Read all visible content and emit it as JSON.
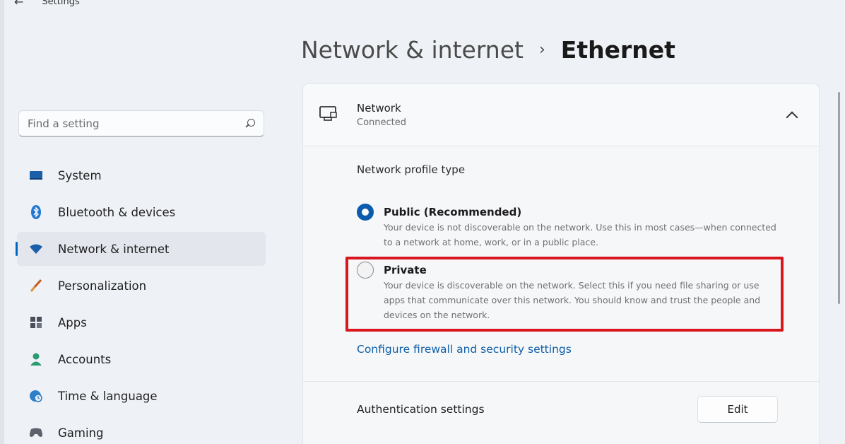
{
  "window": {
    "title": "Settings"
  },
  "search": {
    "placeholder": "Find a setting"
  },
  "sidebar": {
    "items": [
      {
        "label": "System",
        "icon": "monitor-icon"
      },
      {
        "label": "Bluetooth & devices",
        "icon": "bluetooth-icon"
      },
      {
        "label": "Network & internet",
        "icon": "wifi-icon",
        "active": true
      },
      {
        "label": "Personalization",
        "icon": "brush-icon"
      },
      {
        "label": "Apps",
        "icon": "apps-icon"
      },
      {
        "label": "Accounts",
        "icon": "person-icon"
      },
      {
        "label": "Time & language",
        "icon": "globe-clock-icon"
      },
      {
        "label": "Gaming",
        "icon": "controller-icon"
      }
    ]
  },
  "header": {
    "parent": "Network & internet",
    "separator": "›",
    "current": "Ethernet"
  },
  "network_card": {
    "title": "Network",
    "status": "Connected",
    "profile_label": "Network profile type",
    "options": [
      {
        "title": "Public (Recommended)",
        "description": "Your device is not discoverable on the network. Use this in most cases—when connected to a network at home, work, or in a public place.",
        "selected": true
      },
      {
        "title": "Private",
        "description": "Your device is discoverable on the network. Select this if you need file sharing or use apps that communicate over this network. You should know and trust the people and devices on the network.",
        "selected": false
      }
    ],
    "firewall_link": "Configure firewall and security settings"
  },
  "auth": {
    "label": "Authentication settings",
    "edit_label": "Edit"
  },
  "colors": {
    "accent": "#0067c0",
    "highlight": "#d8161d",
    "link": "#0e5ea9"
  }
}
